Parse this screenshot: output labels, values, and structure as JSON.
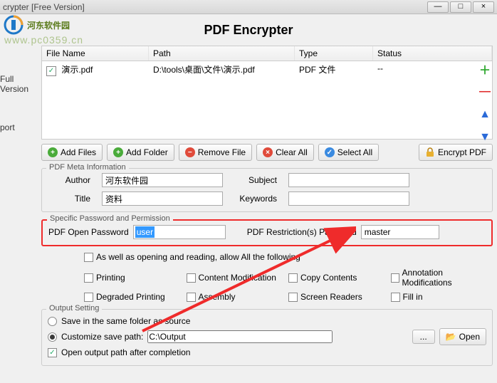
{
  "window": {
    "title": "crypter [Free Version]"
  },
  "logo_text": "河东软件园",
  "watermark": "www.pc0359.cn",
  "header_title": "PDF Encrypter",
  "sidebar": {
    "full_version": "Full Version",
    "port": "port"
  },
  "grid": {
    "headers": {
      "file": "File Name",
      "path": "Path",
      "type": "Type",
      "status": "Status"
    },
    "rows": [
      {
        "checked": true,
        "file": "演示.pdf",
        "path": "D:\\tools\\桌面\\文件\\演示.pdf",
        "type": "PDF 文件",
        "status": "--"
      }
    ]
  },
  "toolbar": {
    "add_files": "Add Files",
    "add_folder": "Add Folder",
    "remove_file": "Remove File",
    "clear_all": "Clear All",
    "select_all": "Select All",
    "encrypt_pdf": "Encrypt PDF"
  },
  "meta": {
    "group_title": "PDF Meta Information",
    "author_label": "Author",
    "author": "河东软件园",
    "subject_label": "Subject",
    "subject": "",
    "title_label": "Title",
    "title": "资料",
    "keywords_label": "Keywords",
    "keywords": ""
  },
  "perm": {
    "group_title": "Specific Password and Permission",
    "open_label": "PDF Open Password",
    "open_value": "user",
    "restrict_label": "PDF Restriction(s) Password",
    "restrict_value": "master",
    "allow_all": "As well as opening and reading, allow All the following",
    "printing": "Printing",
    "content_mod": "Content Modification",
    "copy": "Copy Contents",
    "annot": "Annotation Modifications",
    "degraded": "Degraded Printing",
    "assembly": "Assembly",
    "screen": "Screen Readers",
    "fillin": "Fill in"
  },
  "output": {
    "group_title": "Output Setting",
    "same_folder": "Save in the same folder as source",
    "custom_label": "Customize save path:",
    "custom_path": "C:\\Output",
    "browse": "...",
    "open_btn": "Open",
    "open_after": "Open output path after completion"
  }
}
